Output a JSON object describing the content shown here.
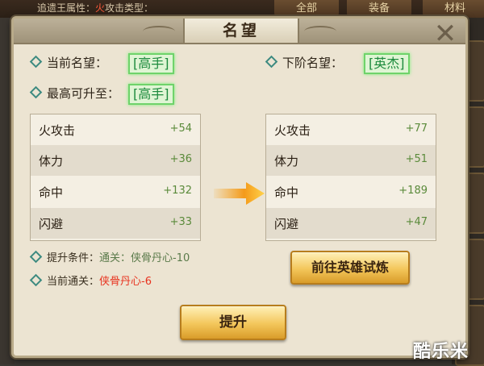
{
  "background": {
    "top_text_prefix": "追遗王属性：",
    "top_text_highlight": "火",
    "top_text_suffix": "攻击类型：",
    "tabs": [
      "全部",
      "装备",
      "材料"
    ]
  },
  "dialog": {
    "title": "名望",
    "close_label": "✕"
  },
  "reputation": {
    "current_label": "当前名望：",
    "current_value": "[高手]",
    "max_label": "最高可升至：",
    "max_value": "[高手]",
    "next_label": "下阶名望：",
    "next_value": "[英杰]"
  },
  "current_stats": [
    {
      "name": "火攻击",
      "value": "+54"
    },
    {
      "name": "体力",
      "value": "+36"
    },
    {
      "name": "命中",
      "value": "+132"
    },
    {
      "name": "闪避",
      "value": "+33"
    }
  ],
  "next_stats": [
    {
      "name": "火攻击",
      "value": "+77"
    },
    {
      "name": "体力",
      "value": "+51"
    },
    {
      "name": "命中",
      "value": "+189"
    },
    {
      "name": "闪避",
      "value": "+47"
    }
  ],
  "conditions": {
    "upgrade_label": "提升条件：",
    "upgrade_value": "通关：侠骨丹心-10",
    "current_label": "当前通关：",
    "current_value": "侠骨丹心-6"
  },
  "buttons": {
    "trial": "前往英雄试炼",
    "upgrade": "提升"
  },
  "watermark": "酷乐米",
  "colors": {
    "rank_green": "#1c8a3c",
    "stat_value_green": "#5a8a3a",
    "warning_red": "#e8321e",
    "button_gold": "#f3c65a"
  }
}
